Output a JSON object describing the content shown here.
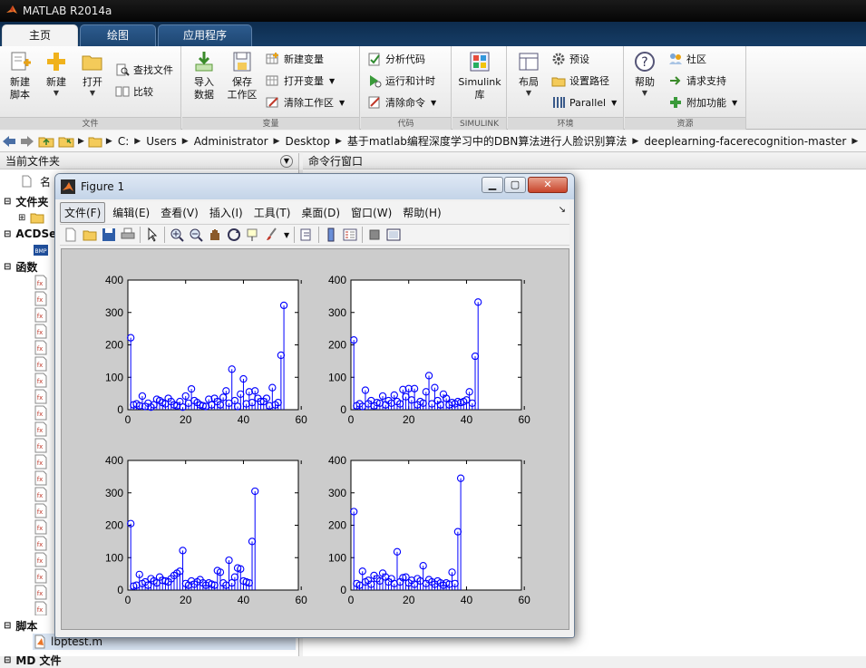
{
  "window": {
    "title": "MATLAB R2014a"
  },
  "tabs": [
    {
      "label": "主页",
      "active": true
    },
    {
      "label": "绘图",
      "active": false
    },
    {
      "label": "应用程序",
      "active": false
    }
  ],
  "ribbon": {
    "file": {
      "label": "文件",
      "new_script_l1": "新建",
      "new_script_l2": "脚本",
      "new": "新建",
      "open": "打开",
      "find_files": "查找文件",
      "compare": "比较"
    },
    "variable": {
      "label": "变量",
      "import_l1": "导入",
      "import_l2": "数据",
      "save_l1": "保存",
      "save_l2": "工作区",
      "new_variable": "新建变量",
      "open_variable": "打开变量",
      "clear_workspace": "清除工作区"
    },
    "code": {
      "label": "代码",
      "analyze": "分析代码",
      "run_time": "运行和计时",
      "clear_commands": "清除命令"
    },
    "simulink": {
      "label": "SIMULINK",
      "btn_l1": "Simulink",
      "btn_l2": "库"
    },
    "environment": {
      "label": "环境",
      "layout": "布局",
      "preferences": "预设",
      "set_path": "设置路径",
      "parallel": "Parallel"
    },
    "resources": {
      "label": "资源",
      "help": "帮助",
      "community": "社区",
      "support": "请求支持",
      "addons": "附加功能"
    }
  },
  "address": {
    "crumbs": [
      "C:",
      "Users",
      "Administrator",
      "Desktop",
      "基于matlab编程深度学习中的DBN算法进行人脸识别算法",
      "deeplearning-facerecognition-master"
    ]
  },
  "left_panel": {
    "title": "当前文件夹",
    "column_name": "名",
    "groups": {
      "folders": "文件夹",
      "acdsee": "ACDSe",
      "functions": "函数",
      "scripts": "脚本",
      "mat": "MD 文件"
    },
    "script_file": "lbptest.m"
  },
  "right_panel": {
    "title": "命令行窗口"
  },
  "figure": {
    "title": "Figure 1",
    "menus": [
      "文件(F)",
      "编辑(E)",
      "查看(V)",
      "插入(I)",
      "工具(T)",
      "桌面(D)",
      "窗口(W)",
      "帮助(H)"
    ]
  },
  "colors": {
    "stem": "#0000ff",
    "axes_bg": "#ffffff",
    "figure_bg": "#cccccc"
  },
  "chart_data": [
    {
      "type": "stem",
      "xlim": [
        0,
        59
      ],
      "ylim": [
        0,
        400
      ],
      "xticks": [
        0,
        20,
        40,
        60
      ],
      "yticks": [
        0,
        100,
        200,
        300,
        400
      ],
      "values": [
        222,
        15,
        18,
        12,
        42,
        10,
        20,
        8,
        15,
        32,
        28,
        22,
        18,
        35,
        25,
        15,
        12,
        25,
        8,
        42,
        20,
        64,
        28,
        22,
        15,
        12,
        10,
        32,
        15,
        35,
        25,
        15,
        38,
        58,
        20,
        125,
        28,
        10,
        48,
        95,
        18,
        55,
        22,
        58,
        35,
        25,
        25,
        35,
        12,
        68,
        15,
        22,
        168,
        322
      ]
    },
    {
      "type": "stem",
      "xlim": [
        0,
        59
      ],
      "ylim": [
        0,
        400
      ],
      "xticks": [
        0,
        20,
        40,
        60
      ],
      "yticks": [
        0,
        100,
        200,
        300,
        400
      ],
      "values": [
        215,
        12,
        18,
        10,
        60,
        18,
        28,
        12,
        22,
        20,
        42,
        15,
        28,
        20,
        45,
        25,
        18,
        62,
        40,
        65,
        30,
        65,
        15,
        25,
        20,
        55,
        105,
        18,
        68,
        28,
        15,
        48,
        35,
        15,
        22,
        18,
        25,
        22,
        25,
        30,
        55,
        20,
        165,
        332
      ]
    },
    {
      "type": "stem",
      "xlim": [
        0,
        59
      ],
      "ylim": [
        0,
        400
      ],
      "xticks": [
        0,
        20,
        40,
        60
      ],
      "yticks": [
        0,
        100,
        200,
        300,
        400
      ],
      "values": [
        205,
        12,
        15,
        48,
        20,
        25,
        15,
        35,
        28,
        22,
        40,
        30,
        28,
        25,
        35,
        45,
        52,
        58,
        122,
        20,
        15,
        28,
        18,
        25,
        32,
        22,
        15,
        22,
        18,
        15,
        60,
        55,
        22,
        15,
        92,
        22,
        40,
        68,
        65,
        28,
        25,
        22,
        150,
        305
      ]
    },
    {
      "type": "stem",
      "xlim": [
        0,
        59
      ],
      "ylim": [
        0,
        400
      ],
      "xticks": [
        0,
        20,
        40,
        60
      ],
      "yticks": [
        0,
        100,
        200,
        300,
        400
      ],
      "values": [
        242,
        20,
        15,
        58,
        25,
        30,
        18,
        45,
        35,
        28,
        52,
        40,
        25,
        35,
        20,
        118,
        25,
        38,
        40,
        22,
        30,
        18,
        35,
        28,
        75,
        20,
        32,
        25,
        18,
        28,
        22,
        15,
        22,
        18,
        55,
        20,
        180,
        345
      ]
    }
  ]
}
